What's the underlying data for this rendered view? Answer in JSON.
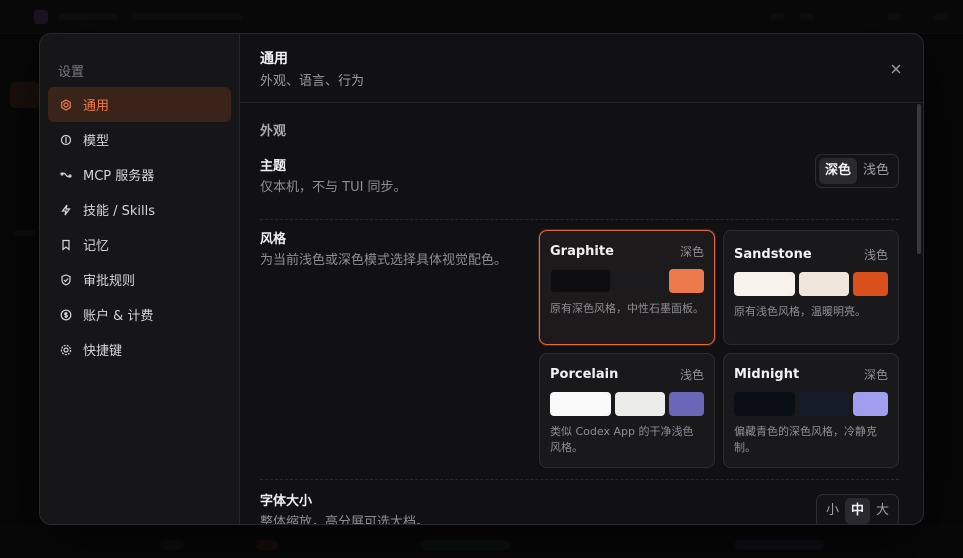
{
  "settings": {
    "heading": "设置",
    "nav": [
      {
        "label": "通用",
        "icon": "gear-icon",
        "active": true
      },
      {
        "label": "模型",
        "icon": "model-icon",
        "active": false
      },
      {
        "label": "MCP 服务器",
        "icon": "plug-icon",
        "active": false
      },
      {
        "label": "技能 / Skills",
        "icon": "bolt-icon",
        "active": false
      },
      {
        "label": "记忆",
        "icon": "bookmark-icon",
        "active": false
      },
      {
        "label": "审批规则",
        "icon": "shield-icon",
        "active": false
      },
      {
        "label": "账户 & 计费",
        "icon": "dollar-icon",
        "active": false
      },
      {
        "label": "快捷键",
        "icon": "keyboard-icon",
        "active": false
      }
    ]
  },
  "header": {
    "title": "通用",
    "subtitle": "外观、语言、行为",
    "close_icon": "close-icon"
  },
  "appearance": {
    "section_title": "外观",
    "theme": {
      "label": "主题",
      "desc": "仅本机，不与 TUI 同步。",
      "options": [
        "深色",
        "浅色"
      ],
      "selected": "深色"
    },
    "style": {
      "label": "风格",
      "desc": "为当前浅色或深色模式选择具体视觉配色。",
      "cards": [
        {
          "name": "Graphite",
          "mode": "深色",
          "desc": "原有深色风格，中性石墨面板。",
          "swatches": [
            "#0e0e10",
            "#1b1b1e",
            "#ec7a4d"
          ],
          "selected": true
        },
        {
          "name": "Sandstone",
          "mode": "浅色",
          "desc": "原有浅色风格，温暖明亮。",
          "swatches": [
            "#f7f3ec",
            "#efe5da",
            "#d9501d"
          ],
          "selected": false
        },
        {
          "name": "Porcelain",
          "mode": "浅色",
          "desc": "类似 Codex App 的干净浅色风格。",
          "swatches": [
            "#fafafa",
            "#ececea",
            "#6a66b8"
          ],
          "selected": false
        },
        {
          "name": "Midnight",
          "mode": "深色",
          "desc": "偏藏青色的深色风格，冷静克制。",
          "swatches": [
            "#0a0e17",
            "#171c2a",
            "#a19ef0"
          ],
          "selected": false
        }
      ]
    },
    "font_size": {
      "label": "字体大小",
      "desc": "整体缩放，高分屏可选大档。",
      "options": [
        "小",
        "中",
        "大"
      ],
      "selected": "中"
    }
  },
  "colors": {
    "accent": "#ec7a4d",
    "selected_border": "#e2683d"
  }
}
